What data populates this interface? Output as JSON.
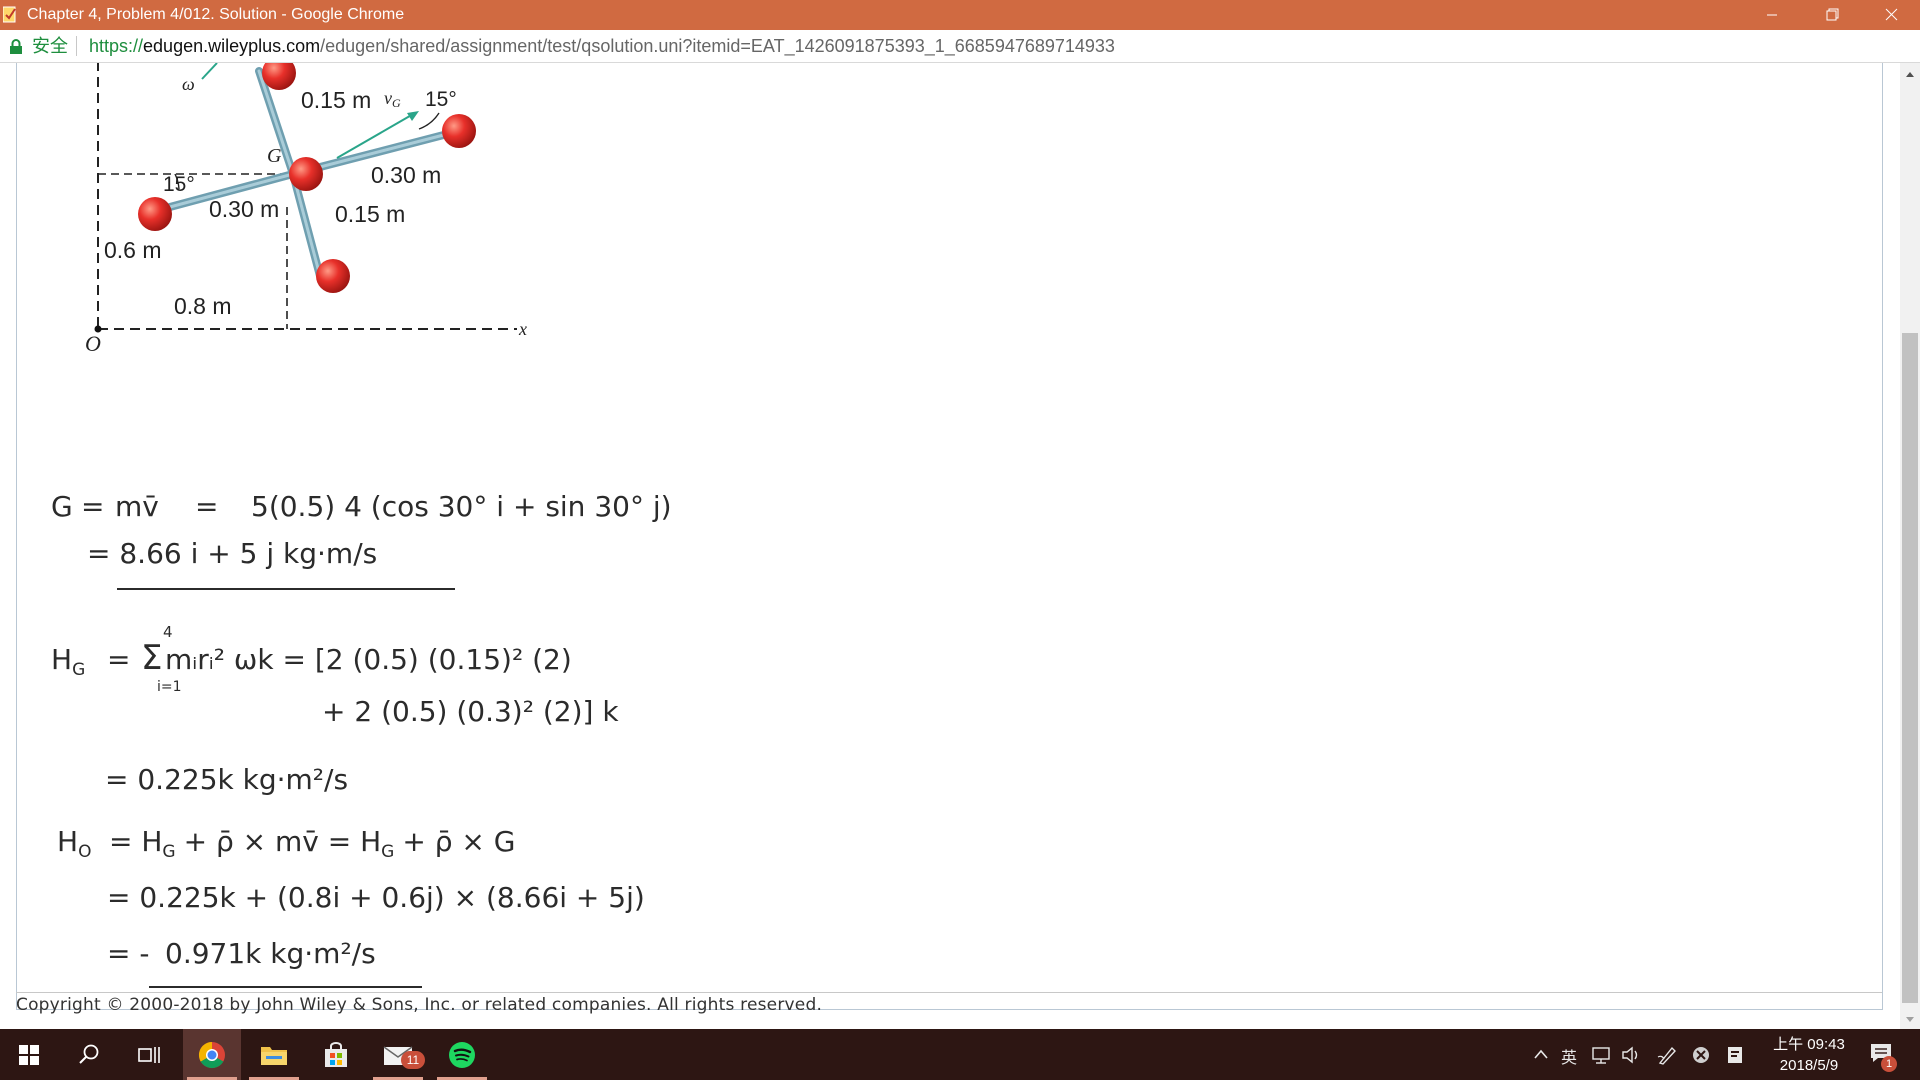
{
  "window": {
    "title": "Chapter 4, Problem 4/012. Solution - Google Chrome",
    "titlebar_color": "#d06a41"
  },
  "addressbar": {
    "security_label": "安全",
    "url_scheme": "https://",
    "url_host": "edugen.wileyplus.com",
    "url_path": "/edugen/shared/assignment/test/qsolution.uni?itemid=EAT_1426091875393_1_6685947689714933"
  },
  "figure": {
    "omega": "ω",
    "vg": "v",
    "vg_sub": "G",
    "g_label": "G",
    "o_label": "O",
    "x_label": "x",
    "angle_top": "15°",
    "angle_left": "15°",
    "len_upper_arm": "0.15 m",
    "len_right_arm": "0.30 m",
    "len_left_arm": "0.30 m",
    "len_lower_arm": "0.15 m",
    "dim_vertical": "0.6 m",
    "dim_horizontal": "0.8 m",
    "sphere_color": "#e8302a"
  },
  "solution": {
    "l1_lhs": "G",
    "l1_eq": "=",
    "l1_mv": "mv̄",
    "l1_eq2": "=",
    "l1_rhs": "5(0.5) 4 (cos 30° i + sin 30° j)",
    "l2": "= 8.66 i + 5 j    kg·m/s",
    "l3_lhs": "H",
    "l3_sub": "G",
    "l3_eq": "=",
    "l3_sum_top": "4",
    "l3_sum_bot": "i=1",
    "l3_sum_body": "mᵢrᵢ² ωk = [2 (0.5) (0.15)² (2)",
    "l4": "+ 2 (0.5) (0.3)² (2)] k",
    "l5": "= 0.225k kg·m²/s",
    "l6_lhs": "H",
    "l6_sub": "O",
    "l6_rhs": "= H",
    "l6_rhs_sub": "G",
    "l6_mid": "+ ρ̄ × mv̄   =   H",
    "l6_mid_sub": "G",
    "l6_tail": "+ ρ̄ × G",
    "l7": "= 0.225k + (0.8i + 0.6j) × (8.66i + 5j)",
    "l8_pre": "= -",
    "l8": "0.971k kg·m²/s"
  },
  "footer": {
    "copyright": "Copyright © 2000-2018 by John Wiley & Sons, Inc. or related companies. All rights reserved."
  },
  "taskbar": {
    "items": [
      "windows-start",
      "search",
      "task-view",
      "chrome",
      "file-explorer",
      "store",
      "mail",
      "spotify"
    ],
    "mail_badge": "11",
    "tray_ime": "英",
    "clock_time": "上午 09:43",
    "clock_date": "2018/5/9",
    "notification_count": "1"
  }
}
